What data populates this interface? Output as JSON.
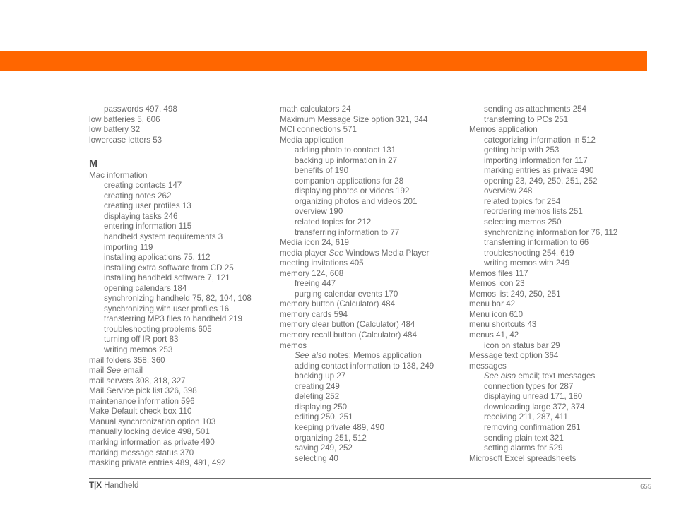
{
  "page": {
    "header_band_color": "#ff6600",
    "text_color": "#6b6b6b",
    "page_number": "655"
  },
  "footer": {
    "product_mark": "T|X",
    "product_name": " Handheld"
  },
  "columns": [
    {
      "id": "column-1",
      "entries": [
        {
          "level": 2,
          "text": "passwords 497, 498"
        },
        {
          "level": 1,
          "text": "low batteries 5, 606"
        },
        {
          "level": 1,
          "text": "low battery 32"
        },
        {
          "level": 1,
          "text": "lowercase letters 53"
        },
        {
          "level": 0,
          "text": ""
        },
        {
          "level": 0,
          "text": "M",
          "style": "letter"
        },
        {
          "level": 1,
          "text": "Mac information"
        },
        {
          "level": 2,
          "text": "creating contacts 147"
        },
        {
          "level": 2,
          "text": "creating notes 262"
        },
        {
          "level": 2,
          "text": "creating user profiles 13"
        },
        {
          "level": 2,
          "text": "displaying tasks 246"
        },
        {
          "level": 2,
          "text": "entering information 115"
        },
        {
          "level": 2,
          "text": "handheld system requirements 3"
        },
        {
          "level": 2,
          "text": "importing 119"
        },
        {
          "level": 2,
          "text": "installing applications 75, 112"
        },
        {
          "level": 2,
          "text": "installing extra software from CD 25"
        },
        {
          "level": 2,
          "text": "installing handheld software 7, 121"
        },
        {
          "level": 2,
          "text": "opening calendars 184"
        },
        {
          "level": 2,
          "text": "synchronizing handheld 75, 82, 104, 108"
        },
        {
          "level": 2,
          "text": "synchronizing with user profiles 16"
        },
        {
          "level": 2,
          "text": "transferring MP3 files to handheld 219"
        },
        {
          "level": 2,
          "text": "troubleshooting problems 605"
        },
        {
          "level": 2,
          "text": "turning off IR port 83"
        },
        {
          "level": 2,
          "text": "writing memos 253"
        },
        {
          "level": 1,
          "text": "mail folders 358, 360"
        },
        {
          "level": 1,
          "text": "mail |See| email",
          "italic": "See"
        },
        {
          "level": 1,
          "text": "mail servers 308, 318, 327"
        },
        {
          "level": 1,
          "text": "Mail Service pick list 326, 398"
        },
        {
          "level": 1,
          "text": "maintenance information 596"
        },
        {
          "level": 1,
          "text": "Make Default check box 110"
        },
        {
          "level": 1,
          "text": "Manual synchronization option 103"
        },
        {
          "level": 1,
          "text": "manually locking device 498, 501"
        },
        {
          "level": 1,
          "text": "marking information as private 490"
        },
        {
          "level": 1,
          "text": "marking message status 370"
        },
        {
          "level": 1,
          "text": "masking private entries 489, 491, 492"
        }
      ]
    },
    {
      "id": "column-2",
      "entries": [
        {
          "level": 1,
          "text": "math calculators 24"
        },
        {
          "level": 1,
          "text": "Maximum Message Size option 321, 344"
        },
        {
          "level": 1,
          "text": "MCI connections 571"
        },
        {
          "level": 1,
          "text": "Media application"
        },
        {
          "level": 2,
          "text": "adding photo to contact 131"
        },
        {
          "level": 2,
          "text": "backing up information in 27"
        },
        {
          "level": 2,
          "text": "benefits of 190"
        },
        {
          "level": 2,
          "text": "companion applications for 28"
        },
        {
          "level": 2,
          "text": "displaying photos or videos 192"
        },
        {
          "level": 2,
          "text": "organizing photos and videos 201"
        },
        {
          "level": 2,
          "text": "overview 190"
        },
        {
          "level": 2,
          "text": "related topics for 212"
        },
        {
          "level": 2,
          "text": "transferring information to 77"
        },
        {
          "level": 1,
          "text": "Media icon 24, 619"
        },
        {
          "level": 1,
          "text": "media player |See| Windows Media Player",
          "italic": "See"
        },
        {
          "level": 1,
          "text": "meeting invitations 405"
        },
        {
          "level": 1,
          "text": "memory 124, 608"
        },
        {
          "level": 2,
          "text": "freeing 447"
        },
        {
          "level": 2,
          "text": "purging calendar events 170"
        },
        {
          "level": 1,
          "text": "memory button (Calculator) 484"
        },
        {
          "level": 1,
          "text": "memory cards 594"
        },
        {
          "level": 1,
          "text": "memory clear button (Calculator) 484"
        },
        {
          "level": 1,
          "text": "memory recall button (Calculator) 484"
        },
        {
          "level": 1,
          "text": "memos"
        },
        {
          "level": 2,
          "text": "|See also| notes; Memos application",
          "italic": "See also"
        },
        {
          "level": 2,
          "text": "adding contact information to 138, 249"
        },
        {
          "level": 2,
          "text": "backing up 27"
        },
        {
          "level": 2,
          "text": "creating 249"
        },
        {
          "level": 2,
          "text": "deleting 252"
        },
        {
          "level": 2,
          "text": "displaying 250"
        },
        {
          "level": 2,
          "text": "editing 250, 251"
        },
        {
          "level": 2,
          "text": "keeping private 489, 490"
        },
        {
          "level": 2,
          "text": "organizing 251, 512"
        },
        {
          "level": 2,
          "text": "saving 249, 252"
        },
        {
          "level": 2,
          "text": "selecting 40"
        }
      ]
    },
    {
      "id": "column-3",
      "entries": [
        {
          "level": 2,
          "text": "sending as attachments 254"
        },
        {
          "level": 2,
          "text": "transferring to PCs 251"
        },
        {
          "level": 1,
          "text": "Memos application"
        },
        {
          "level": 2,
          "text": "categorizing information in 512"
        },
        {
          "level": 2,
          "text": "getting help with 253"
        },
        {
          "level": 2,
          "text": "importing information for 117"
        },
        {
          "level": 2,
          "text": "marking entries as private 490"
        },
        {
          "level": 2,
          "text": "opening 23, 249, 250, 251, 252"
        },
        {
          "level": 2,
          "text": "overview 248"
        },
        {
          "level": 2,
          "text": "related topics for 254"
        },
        {
          "level": 2,
          "text": "reordering memos lists 251"
        },
        {
          "level": 2,
          "text": "selecting memos 250"
        },
        {
          "level": 2,
          "text": "synchronizing information for 76, 112"
        },
        {
          "level": 2,
          "text": "transferring information to 66"
        },
        {
          "level": 2,
          "text": "troubleshooting 254, 619"
        },
        {
          "level": 2,
          "text": "writing memos with 249"
        },
        {
          "level": 1,
          "text": "Memos files 117"
        },
        {
          "level": 1,
          "text": "Memos icon 23"
        },
        {
          "level": 1,
          "text": "Memos list 249, 250, 251"
        },
        {
          "level": 1,
          "text": "menu bar 42"
        },
        {
          "level": 1,
          "text": "Menu icon 610"
        },
        {
          "level": 1,
          "text": "menu shortcuts 43"
        },
        {
          "level": 1,
          "text": "menus 41, 42"
        },
        {
          "level": 2,
          "text": "icon on status bar 29"
        },
        {
          "level": 1,
          "text": "Message text option 364"
        },
        {
          "level": 1,
          "text": "messages"
        },
        {
          "level": 2,
          "text": "|See also| email; text messages",
          "italic": "See also"
        },
        {
          "level": 2,
          "text": "connection types for 287"
        },
        {
          "level": 2,
          "text": "displaying unread 171, 180"
        },
        {
          "level": 2,
          "text": "downloading large 372, 374"
        },
        {
          "level": 2,
          "text": "receiving 211, 287, 411"
        },
        {
          "level": 2,
          "text": "removing confirmation 261"
        },
        {
          "level": 2,
          "text": "sending plain text 321"
        },
        {
          "level": 2,
          "text": "setting alarms for 529"
        },
        {
          "level": 1,
          "text": "Microsoft Excel spreadsheets"
        }
      ]
    }
  ]
}
